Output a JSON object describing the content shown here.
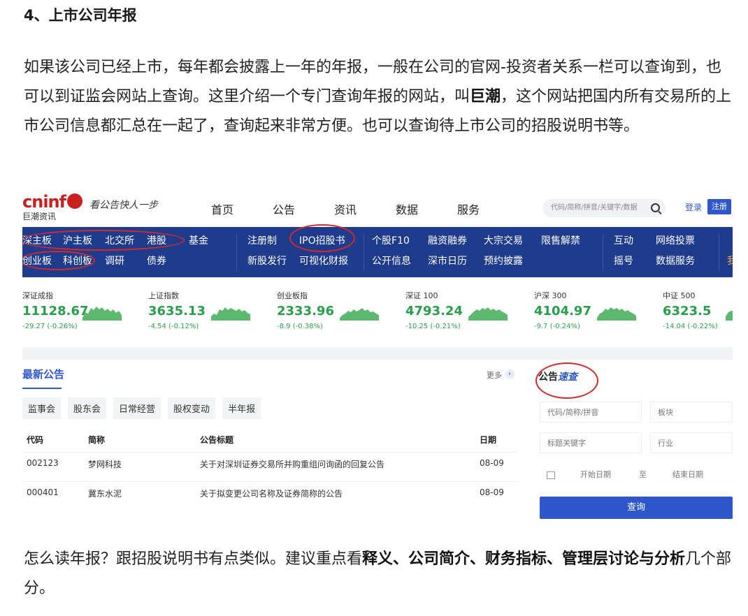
{
  "article": {
    "heading": "4、上市公司年报",
    "para1_a": "如果该公司已经上市，每年都会披露上一年的年报，一般在公司的官网-投资者关系一栏可以查询到，也可以到证监会网站上查询。这里介绍一个专门查询年报的网站，叫",
    "para1_bold": "巨潮",
    "para1_b": "，这个网站把国内所有交易所的上市公司信息都汇总在一起了，查询起来非常方便。也可以查询待上市公司的招股说明书等。",
    "para2_a": "怎么读年报？跟招股说明书有点类似。建议重点看",
    "para2_bold": "释义、公司简介、财务指标、管理层讨论与分析",
    "para2_b": "几个部分。"
  },
  "site": {
    "logo_text": "cninf",
    "logo_sub": "巨潮资讯",
    "slogan": "看公告快人一步",
    "nav": [
      "首页",
      "公告",
      "资讯",
      "数据",
      "服务"
    ],
    "search_placeholder": "代码/简称/拼音/关键字/数据",
    "login": "登录",
    "register": "注册",
    "menu_row1": [
      "深主板",
      "沪主板",
      "北交所",
      "港股",
      "基金",
      "注册制",
      "IPO招股书",
      "个股F10",
      "融资融券",
      "大宗交易",
      "限售解禁",
      "互动",
      "网络投票"
    ],
    "menu_row2": [
      "创业板",
      "科创板",
      "调研",
      "债券",
      "新股发行",
      "可视化财报",
      "公开信息",
      "深市日历",
      "预约披露",
      "摇号",
      "数据服务"
    ],
    "menu_cut": "我",
    "indexes": [
      {
        "name": "深证成指",
        "value": "11128.67",
        "change": "-29.27 (-0.26%)"
      },
      {
        "name": "上证指数",
        "value": "3635.13",
        "change": "-4.54 (-0.12%)"
      },
      {
        "name": "创业板指",
        "value": "2333.96",
        "change": "-8.9 (-0.38%)"
      },
      {
        "name": "深证 100",
        "value": "4793.24",
        "change": "-10.25 (-0.21%)"
      },
      {
        "name": "沪深 300",
        "value": "4104.97",
        "change": "-9.7 (-0.24%)"
      },
      {
        "name": "中证 500",
        "value": "6323.5",
        "change": "-14.04 (-0.22%)"
      }
    ],
    "latest": {
      "title": "最新公告",
      "more": "更多",
      "tabs": [
        "监事会",
        "股东会",
        "日常经营",
        "股权变动",
        "半年报"
      ],
      "columns": [
        "代码",
        "简称",
        "公告标题",
        "日期"
      ],
      "rows": [
        {
          "code": "002123",
          "name": "梦网科技",
          "title": "关于对深圳证券交易所并购重组问询函的回复公告",
          "date": "08-09"
        },
        {
          "code": "000401",
          "name": "冀东水泥",
          "title": "关于拟变更公司名称及证券简称的公告",
          "date": "08-09"
        }
      ]
    },
    "quick": {
      "title_a": "公告",
      "title_b": "速查",
      "code_placeholder": "代码/简称/拼音",
      "board_placeholder": "板块",
      "keyword_placeholder": "标题关键字",
      "industry_placeholder": "行业",
      "start_date": "开始日期",
      "to": "至",
      "end_date": "结束日期",
      "query_button": "查询"
    }
  },
  "colors": {
    "brand_blue": "#1f3b8c",
    "accent_blue": "#2f57c9",
    "logo_red": "#c8201f",
    "index_green": "#2a9d4c",
    "annotation_red": "#d42a2a"
  }
}
